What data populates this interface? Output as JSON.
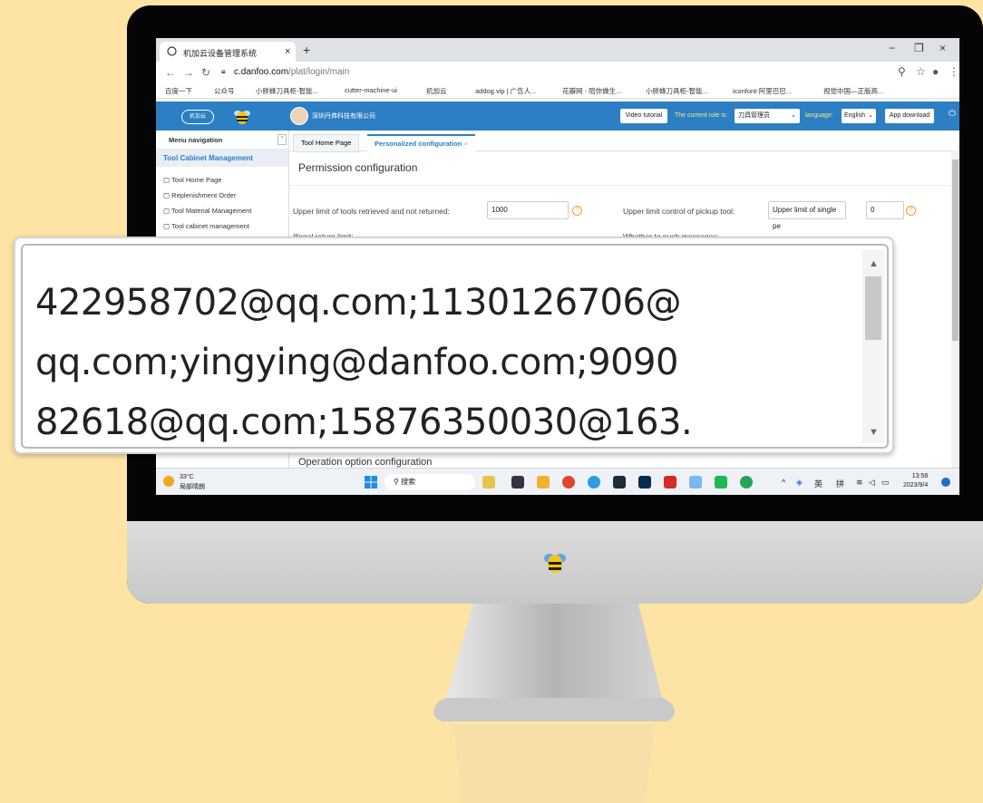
{
  "browser": {
    "tab_title": "机加云设备管理系统",
    "url_domain": "c.danfoo.com",
    "url_path": "/plat/login/main",
    "bookmarks": [
      "百度一下",
      "公众号",
      "小胖蜂刀具柜-智能...",
      "cutter-machine-ui",
      "机加云",
      "addog.vip | 广告人...",
      "花瓣网 - 陪你做生...",
      "小胖蜂刀具柜-智能...",
      "iconfont-阿里巴巴...",
      "视觉中国—正版高..."
    ]
  },
  "header": {
    "logo": "机加云",
    "company": "深圳丹弗科技有限公司",
    "video_tutorial": "Video tutorial",
    "role_label": "The current role is:",
    "role_value": "刀具管理员",
    "language_label": "language:",
    "language_value": "English",
    "app_download": "App download"
  },
  "sidebar": {
    "title": "Menu navigation",
    "group": "Tool Cabinet Management",
    "items": [
      "Tool Home Page",
      "Replenishment Order",
      "Tool Material Management",
      "Tool cabinet management"
    ]
  },
  "tabs": [
    "Tool Home Page",
    "Personalized configuration"
  ],
  "content": {
    "section_title": "Permission configuration",
    "field1_label": "Upper limit of tools retrieved and not returned:",
    "field1_value": "1000",
    "field2_label": "Upper limit control of pickup tool:",
    "field2_select": "Upper limit of single pe",
    "field2_value": "0",
    "illegal_return": "Illegal return limit:",
    "push_messages": "Whether to push messages:",
    "section2_title": "Operation option configuration"
  },
  "taskbar": {
    "weather_temp": "33°C",
    "weather_desc": "局部晴朗",
    "search": "搜索",
    "ime1": "英",
    "ime2": "拼",
    "time": "13:58",
    "date": "2023/9/4"
  },
  "zoom": {
    "lines": [
      "422958702@qq.com;1130126706@",
      "qq.com;yingying@danfoo.com;9090",
      "82618@qq.com;15876350030@163."
    ]
  },
  "colors": {
    "background": "#fde4a4",
    "app_blue": "#2c7fc3",
    "accent_orange": "#f0a030"
  }
}
